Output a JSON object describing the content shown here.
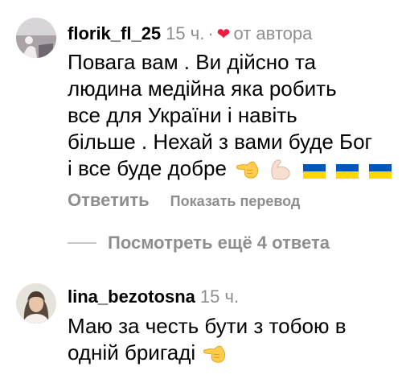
{
  "comments": [
    {
      "username": "florik_fl_25",
      "time": "15 ч.",
      "dot": "·",
      "author_badge": "от автора",
      "heart_icon": "heart-icon",
      "lines": [
        "Повага вам . Ви дійсно та",
        "людина медійна яка робить",
        "все для України і навіть",
        "більше . Нехай з вами буде Бог",
        "і все буде добре"
      ],
      "emojis": [
        "pointing-hand-emoji",
        "flexed-biceps-emoji",
        "ukraine-flag-emoji",
        "ukraine-flag-emoji",
        "ukraine-flag-emoji"
      ],
      "reply_label": "Ответить",
      "translate_label": "Показать перевод"
    },
    {
      "username": "lina_bezotosna",
      "time": "15 ч.",
      "lines": [
        "Маю за честь бути з тобою в",
        "одній бригаді"
      ],
      "emojis": [
        "pointing-hand-emoji"
      ]
    }
  ],
  "view_replies_label": "Посмотреть ещё 4 ответа",
  "colors": {
    "secondary_text": "#8e8e8e",
    "heart": "#ed1c3e",
    "flag_blue": "#0057b7",
    "flag_yellow": "#ffd700"
  }
}
